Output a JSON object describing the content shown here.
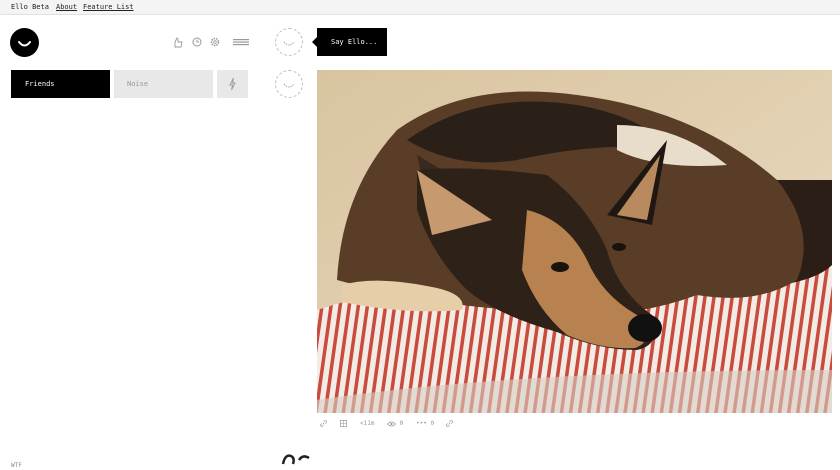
{
  "topbar": {
    "title": "Ello Beta",
    "about": "About",
    "features": "Feature List"
  },
  "nav": {
    "friends": "Friends",
    "noise": "Noise"
  },
  "composer": {
    "placeholder": "Say Ello..."
  },
  "post": {
    "image_subject": "German Shepherd dog resting on a red-and-white striped cushion",
    "time": "11m",
    "views": "0",
    "comments": "0"
  },
  "footer": {
    "wtf": "WTF"
  },
  "colors": {
    "black": "#000000",
    "nav_inactive": "#e8e8e8",
    "topbar_bg": "#f4f4f4"
  }
}
